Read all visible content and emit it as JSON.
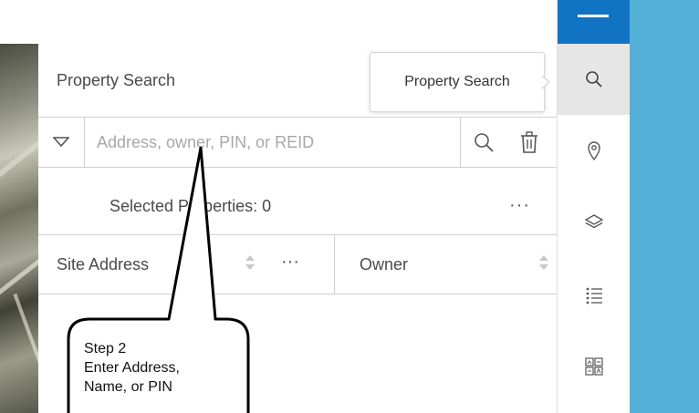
{
  "panel": {
    "title": "Property Search",
    "search": {
      "placeholder": "Address, owner, PIN, or REID"
    },
    "selected_label": "Selected Properties: 0",
    "more_label": "···",
    "columns": [
      {
        "label": "Site Address"
      },
      {
        "label": "Owner"
      }
    ]
  },
  "tooltip": {
    "text": "Property Search"
  },
  "sidebar": {
    "items": [
      {
        "icon": "search-icon",
        "active": true
      },
      {
        "icon": "location-pin-icon"
      },
      {
        "icon": "layers-icon"
      },
      {
        "icon": "list-icon"
      },
      {
        "icon": "basemap-grid-icon"
      }
    ]
  },
  "callout": {
    "line1": "Step 2",
    "line2": "Enter Address,",
    "line3": "Name, or PIN"
  },
  "colors": {
    "accent": "#1173c4",
    "water": "#55b0d8"
  }
}
